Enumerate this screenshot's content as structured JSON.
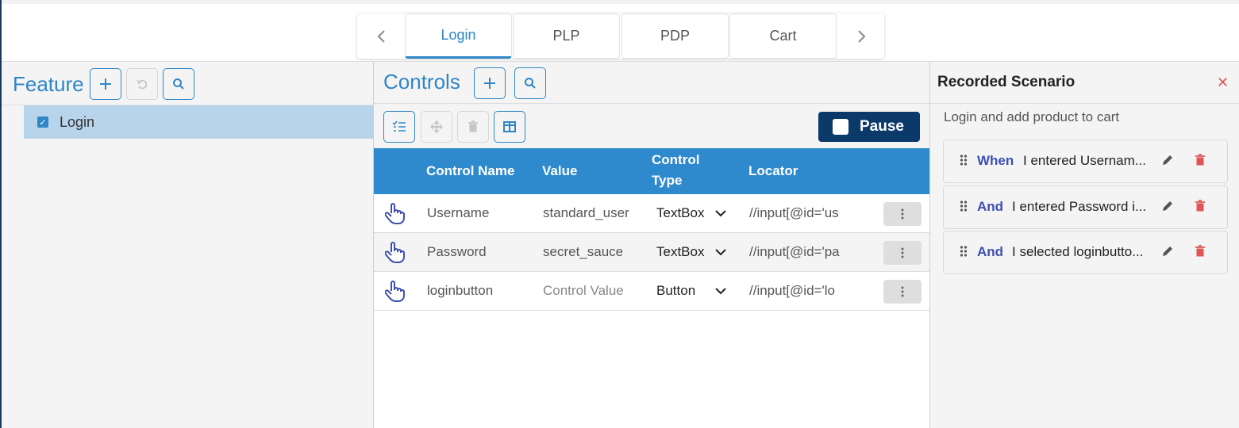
{
  "tabs": {
    "prev_icon": "chevron-left-icon",
    "next_icon": "chevron-right-icon",
    "items": [
      {
        "label": "Login",
        "active": true
      },
      {
        "label": "PLP",
        "active": false
      },
      {
        "label": "PDP",
        "active": false
      },
      {
        "label": "Cart",
        "active": false
      }
    ]
  },
  "feature": {
    "title": "Feature",
    "items": [
      {
        "label": "Login",
        "checked": true,
        "selected": true
      }
    ]
  },
  "controls": {
    "title": "Controls",
    "pause_label": "Pause",
    "columns": [
      "Control Name",
      "Value",
      "Control Type",
      "Locator"
    ],
    "rows": [
      {
        "name": "Username",
        "value": "standard_user",
        "value_is_placeholder": false,
        "type": "TextBox",
        "locator": "//input[@id='us"
      },
      {
        "name": "Password",
        "value": "secret_sauce",
        "value_is_placeholder": false,
        "type": "TextBox",
        "locator": "//input[@id='pa"
      },
      {
        "name": "loginbutton",
        "value": "Control Value",
        "value_is_placeholder": true,
        "type": "Button",
        "locator": "//input[@id='lo"
      }
    ]
  },
  "recorded": {
    "title": "Recorded Scenario",
    "description": "Login and add product to cart",
    "steps": [
      {
        "keyword": "When",
        "text": "I entered Usernam..."
      },
      {
        "keyword": "And",
        "text": "I entered Password i..."
      },
      {
        "keyword": "And",
        "text": "I selected loginbutto..."
      }
    ]
  },
  "colors": {
    "accent": "#2f86c6",
    "pause_bg": "#0b3a6a",
    "keyword": "#3d4fb0",
    "danger": "#e05555",
    "selection": "#b8d4ea"
  }
}
